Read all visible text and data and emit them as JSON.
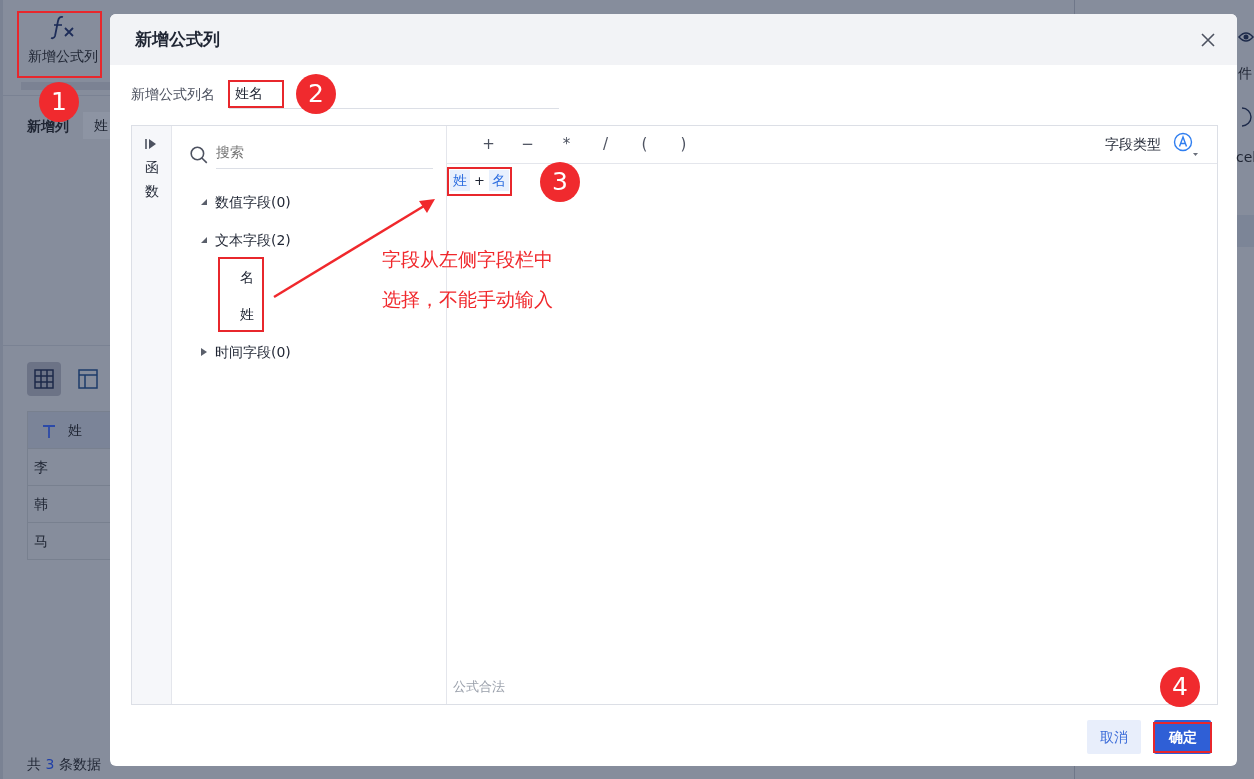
{
  "background": {
    "toolbar_button": {
      "label": "新增公式列"
    },
    "new_column_label": "新增列",
    "new_column_chip": "姓",
    "views": [
      {
        "kind": "grid",
        "selected": true
      },
      {
        "kind": "layout",
        "selected": false
      }
    ],
    "table": {
      "columns": [
        "姓"
      ],
      "rows": [
        [
          "李"
        ],
        [
          "韩"
        ],
        [
          "马"
        ]
      ]
    },
    "footer": {
      "prefix": "共",
      "count": "3",
      "suffix": "条数据"
    },
    "right_texts": [
      "件",
      "cel"
    ]
  },
  "dialog": {
    "title": "新增公式列",
    "name_label": "新增公式列名",
    "name_value": "姓名",
    "side_tab": "函数",
    "search": {
      "placeholder": "搜索"
    },
    "tree": [
      {
        "label": "数值字段(0)",
        "expanded": true
      },
      {
        "label": "文本字段(2)",
        "expanded": true,
        "children": [
          {
            "label": "名"
          },
          {
            "label": "姓"
          }
        ]
      },
      {
        "label": "时间字段(0)",
        "expanded": false
      }
    ],
    "operators": [
      "+",
      "−",
      "*",
      "/",
      "(",
      ")"
    ],
    "field_type_label": "字段类型",
    "formula": [
      {
        "kind": "field",
        "text": "姓"
      },
      {
        "kind": "operator",
        "text": "+"
      },
      {
        "kind": "field",
        "text": "名"
      }
    ],
    "status": "公式合法",
    "buttons": [
      {
        "label": "取消",
        "kind": "secondary"
      },
      {
        "label": "确定",
        "kind": "primary"
      }
    ]
  },
  "annotations": {
    "steps": [
      "1",
      "2",
      "3",
      "4"
    ],
    "note": [
      "字段从左侧字段栏中",
      "选择，不能手动输入"
    ]
  }
}
